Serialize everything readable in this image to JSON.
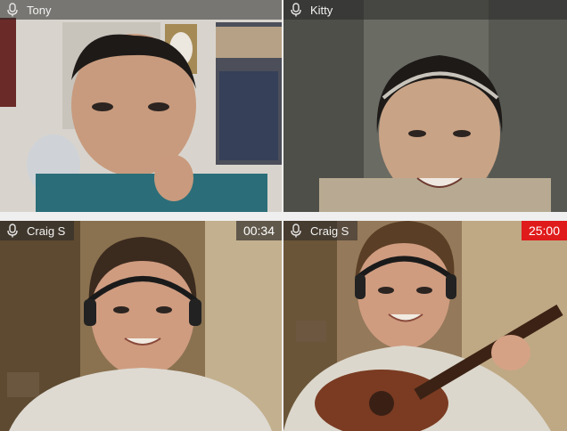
{
  "participants": [
    {
      "name": "Tony"
    },
    {
      "name": "Kitty"
    },
    {
      "name": "Craig S",
      "timer": "00:34"
    },
    {
      "name": "Craig S",
      "timer": "25:00"
    }
  ],
  "colors": {
    "timer_alert": "#e01b1b",
    "namebar": "rgba(40,40,40,0.55)"
  },
  "icons": {
    "mic": "microphone-icon"
  }
}
